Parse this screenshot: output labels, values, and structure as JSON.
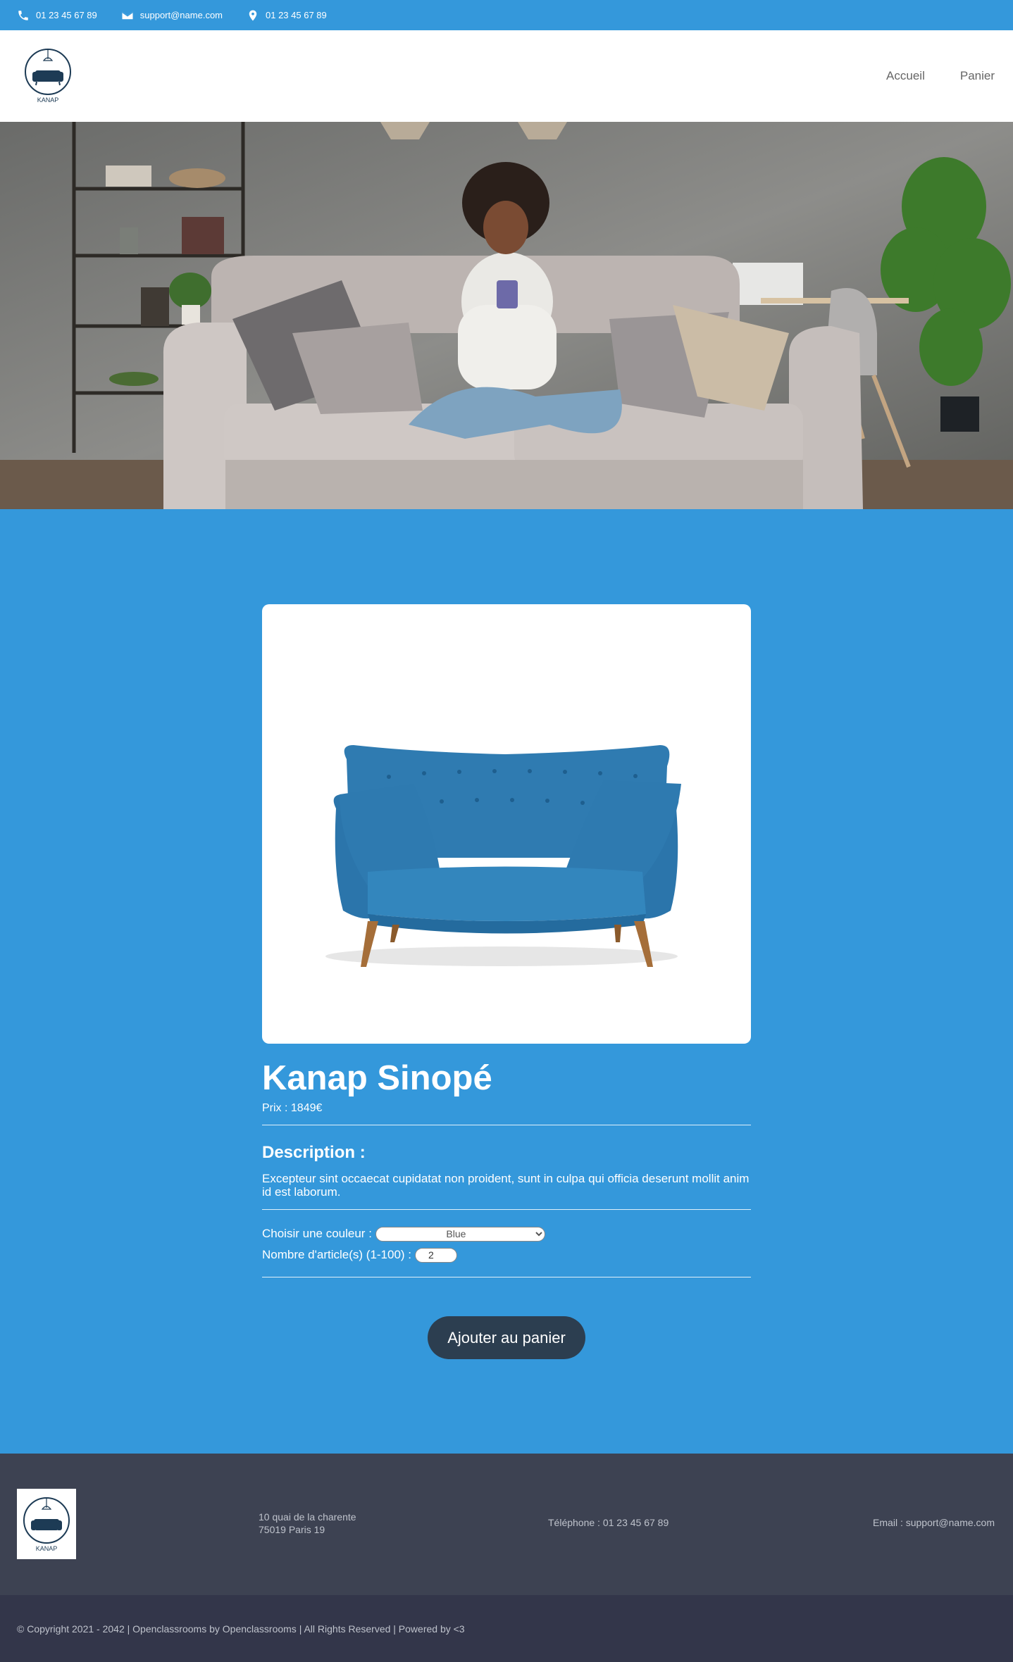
{
  "topbar": {
    "phone": "01 23 45 67 89",
    "email": "support@name.com",
    "location": "01 23 45 67 89"
  },
  "header": {
    "logo_text": "KANAP",
    "nav": [
      "Accueil",
      "Panier"
    ]
  },
  "product": {
    "title": "Kanap Sinopé",
    "price_line": "Prix : 1849€",
    "description_title": "Description :",
    "description": "Excepteur sint occaecat cupidatat non proident, sunt in culpa qui officia deserunt mollit anim id est laborum.",
    "color_label": "Choisir une couleur :",
    "color_selected": "Blue",
    "quantity_label": "Nombre d'article(s) (1-100) :",
    "quantity_value": "2",
    "add_button": "Ajouter au panier"
  },
  "footer": {
    "logo_text": "KANAP",
    "address_line1": "10 quai de la charente",
    "address_line2": "75019 Paris 19",
    "phone": "Téléphone : 01 23 45 67 89",
    "email": "Email : support@name.com",
    "copyright": "© Copyright 2021 - 2042 | Openclassrooms by Openclassrooms | All Rights Reserved | Powered by <3"
  },
  "colors": {
    "primary_blue": "#3498db",
    "dark_button": "#2c3e50",
    "footer_bg": "#3d4252",
    "copyright_bg": "#33364a"
  },
  "icons": [
    "phone-icon",
    "mail-icon",
    "location-pin-icon",
    "logo-sofa-icon"
  ]
}
